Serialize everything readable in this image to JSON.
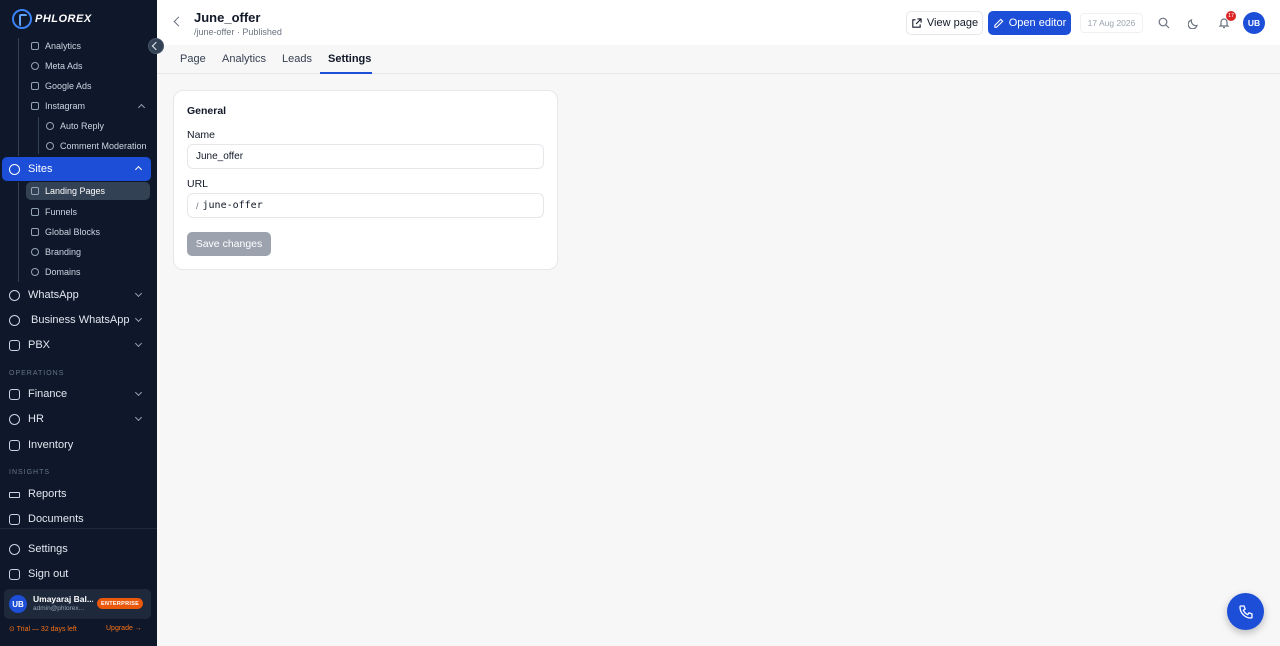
{
  "brand": {
    "name": "PHLOREX"
  },
  "sidebar": {
    "marketing_sub": [
      {
        "label": "Analytics",
        "icon": "bar-chart-icon"
      },
      {
        "label": "Meta Ads",
        "icon": "meta-icon"
      },
      {
        "label": "Google Ads",
        "icon": "bar-chart-icon"
      },
      {
        "label": "Instagram",
        "icon": "instagram-icon"
      }
    ],
    "instagram_sub": [
      {
        "label": "Auto Reply",
        "icon": "message-icon"
      },
      {
        "label": "Comment Moderation",
        "icon": "shield-icon"
      }
    ],
    "sites": {
      "label": "Sites",
      "icon": "globe-icon"
    },
    "sites_sub": [
      {
        "label": "Landing Pages",
        "icon": "layout-icon"
      },
      {
        "label": "Funnels",
        "icon": "funnel-icon"
      },
      {
        "label": "Global Blocks",
        "icon": "blocks-icon"
      },
      {
        "label": "Branding",
        "icon": "palette-icon"
      },
      {
        "label": "Domains",
        "icon": "globe-icon"
      }
    ],
    "channels": [
      {
        "label": "WhatsApp",
        "icon": "whatsapp-icon"
      },
      {
        "label": "Business WhatsApp",
        "icon": "check-circle-icon"
      },
      {
        "label": "PBX",
        "icon": "phone-icon"
      }
    ],
    "operations_heading": "OPERATIONS",
    "operations": [
      {
        "label": "Finance",
        "icon": "bank-icon"
      },
      {
        "label": "HR",
        "icon": "users-icon"
      },
      {
        "label": "Inventory",
        "icon": "box-icon"
      }
    ],
    "insights_heading": "INSIGHTS",
    "insights": [
      {
        "label": "Reports",
        "icon": "trend-icon"
      },
      {
        "label": "Documents",
        "icon": "document-icon"
      }
    ],
    "footer": [
      {
        "label": "Settings",
        "icon": "gear-icon"
      },
      {
        "label": "Sign out",
        "icon": "logout-icon"
      }
    ],
    "user": {
      "initials": "UB",
      "name": "Umayaraj Bal...",
      "email": "admin@phlorex...",
      "plan": "ENTERPRISE"
    },
    "trial_text": "⊙ Trial — 32 days left",
    "upgrade_text": "Upgrade →"
  },
  "header": {
    "title": "June_offer",
    "subtitle": "/june-offer · Published",
    "view_page": "View page",
    "open_editor": "Open editor",
    "date": "17 Aug 2026",
    "notifications_count": "17",
    "avatar_initials": "UB"
  },
  "tabs": [
    {
      "label": "Page"
    },
    {
      "label": "Analytics"
    },
    {
      "label": "Leads"
    },
    {
      "label": "Settings"
    }
  ],
  "settings": {
    "section_title": "General",
    "name_label": "Name",
    "name_value": "June_offer",
    "url_label": "URL",
    "url_prefix": "/",
    "url_value": "june-offer",
    "save_label": "Save changes"
  },
  "colors": {
    "accent": "#1d4ed8",
    "sidebar_bg": "#0f172a",
    "badge": "#ea580c"
  }
}
